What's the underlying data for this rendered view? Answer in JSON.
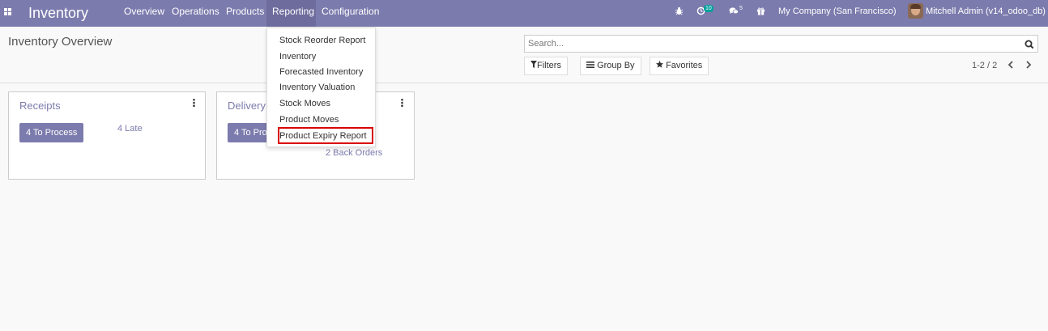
{
  "navbar": {
    "app_name": "Inventory",
    "menu": [
      "Overview",
      "Operations",
      "Products",
      "Reporting",
      "Configuration"
    ],
    "active_menu": "Reporting",
    "activity_count": "10",
    "message_count": "5",
    "company": "My Company (San Francisco)",
    "user": "Mitchell Admin (v14_odoo_db)"
  },
  "control_panel": {
    "title": "Inventory Overview",
    "search_placeholder": "Search...",
    "filters_label": "Filters",
    "group_by_label": "Group By",
    "favorites_label": "Favorites",
    "pager": "1-2 / 2"
  },
  "cards": [
    {
      "title": "Receipts",
      "process_label": "4 To Process",
      "late_label": "4 Late"
    },
    {
      "title": "Delivery Orders",
      "process_label": "4 To Process",
      "back_orders_label": "2 Back Orders"
    }
  ],
  "reporting_menu": {
    "items": [
      "Stock Reorder Report",
      "Inventory",
      "Forecasted Inventory",
      "Inventory Valuation",
      "Stock Moves",
      "Product Moves",
      "Product Expiry Report"
    ],
    "highlighted": "Product Expiry Report"
  },
  "colors": {
    "brand": "#7c7bad",
    "active_menu": "#6d6c9c",
    "highlight_border": "#d90000",
    "badge": "#00a09d"
  }
}
